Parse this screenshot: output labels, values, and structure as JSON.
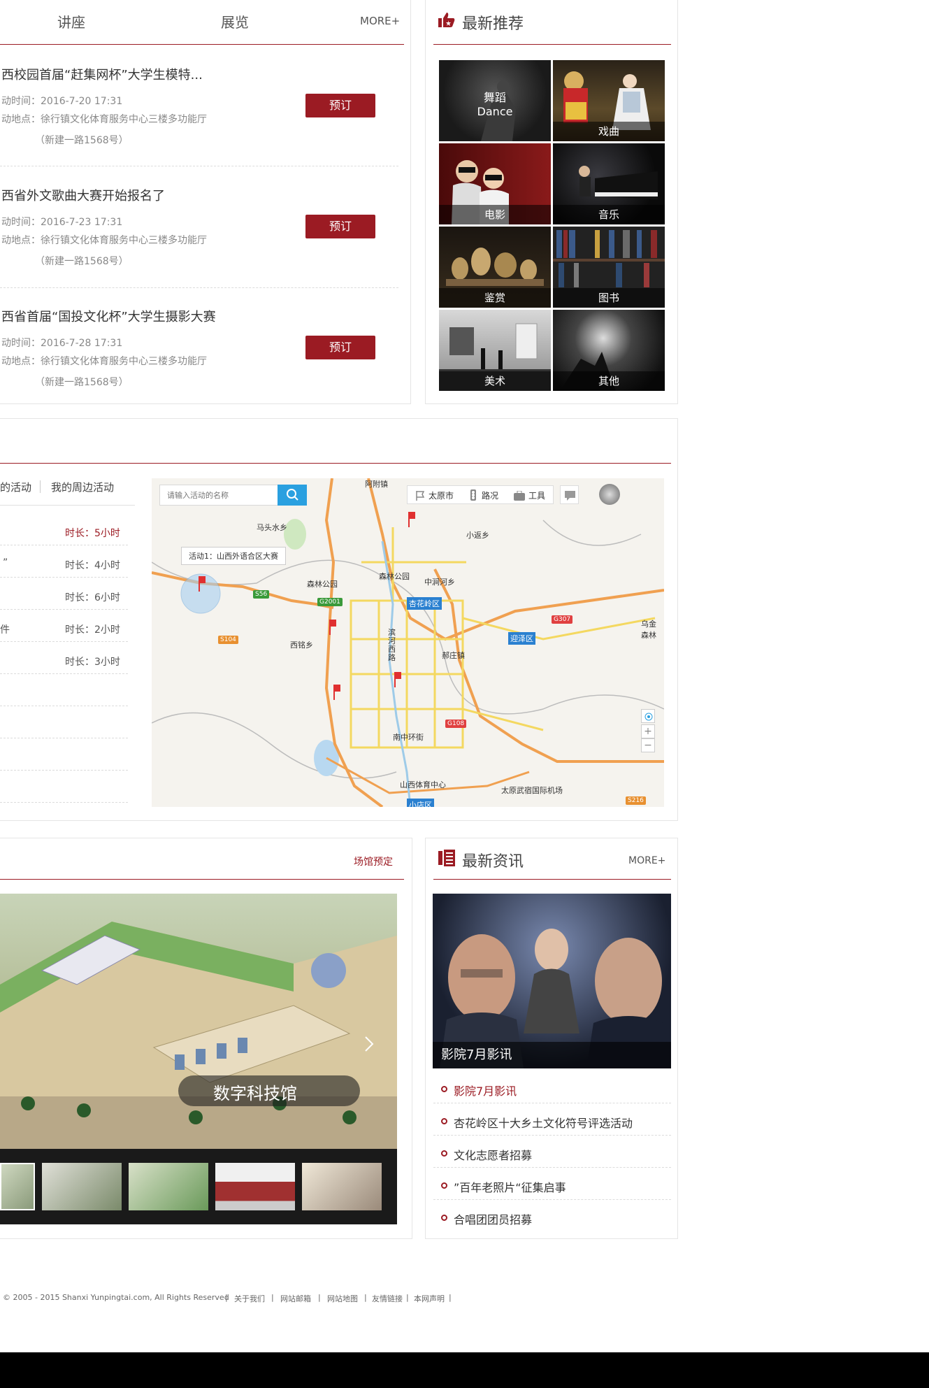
{
  "activities": {
    "tabs": [
      "讲座",
      "展览"
    ],
    "more": "MORE+",
    "items": [
      {
        "title": "西校园首届“赶集网杯”大学生模特...",
        "time": "动时间：2016-7-20 17:31",
        "place": "动地点：徐行镇文化体育服务中心三楼多功能厅",
        "address": "（新建一路1568号）",
        "button": "预订"
      },
      {
        "title": "西省外文歌曲大赛开始报名了",
        "time": "动时间：2016-7-23 17:31",
        "place": "动地点：徐行镇文化体育服务中心三楼多功能厅",
        "address": "（新建一路1568号）",
        "button": "预订"
      },
      {
        "title": "西省首届“国投文化杯”大学生摄影大赛",
        "time": "动时间：2016-7-28 17:31",
        "place": "动地点：徐行镇文化体育服务中心三楼多功能厅",
        "address": "（新建一路1568号）",
        "button": "预订"
      }
    ]
  },
  "recommend": {
    "title": "最新推荐",
    "tiles": [
      {
        "label": "舞蹈",
        "sublabel": "Dance"
      },
      {
        "label": "戏曲"
      },
      {
        "label": "电影"
      },
      {
        "label": "音乐"
      },
      {
        "label": "鉴赏"
      },
      {
        "label": "图书"
      },
      {
        "label": "美术"
      },
      {
        "label": "其他"
      }
    ]
  },
  "nearby": {
    "tabs": [
      "的活动",
      "我的周边活动"
    ],
    "rows": [
      {
        "name": "",
        "duration": "时长：5小时",
        "highlight": true
      },
      {
        "name": "”",
        "duration": "时长：4小时"
      },
      {
        "name": "",
        "duration": "时长：6小时"
      },
      {
        "name": "件",
        "duration": "时长：2小时"
      },
      {
        "name": "",
        "duration": "时长：3小时"
      }
    ],
    "map": {
      "search_placeholder": "请输入活动的名称",
      "city": "太原市",
      "traffic": "路况",
      "tools": "工具",
      "popup": "活动1：山西外语合区大赛",
      "places": [
        "阿附镇",
        "马头水乡",
        "小返乡",
        "森林公园",
        "森林公园",
        "中涧河乡",
        "杏花岭区",
        "迎泽区",
        "西铭乡",
        "郝庄镇",
        "乌金森林",
        "南中环街",
        "山西体育中心",
        "太原武宿国际机场",
        "滨河西路",
        "小店区"
      ],
      "roads": [
        "S56",
        "G2001",
        "S104",
        "G307",
        "G108",
        "S216"
      ]
    }
  },
  "venue": {
    "link": "场馆预定",
    "caption": "数字科技馆"
  },
  "news": {
    "title": "最新资讯",
    "more": "MORE+",
    "feature_caption": "影院7月影讯",
    "items": [
      "影院7月影讯",
      "杏花岭区十大乡土文化符号评选活动",
      "文化志愿者招募",
      "”百年老照片“征集启事",
      "合唱团团员招募"
    ]
  },
  "footer": {
    "copyright": "© 2005 - 2015 Shanxi Yunpingtai.com, All Rights Reserved",
    "links": [
      "关于我们",
      "网站邮箱",
      "网站地图",
      "友情链接",
      "本网声明"
    ]
  },
  "colors": {
    "accent": "#9b1b23",
    "link_blue": "#2aa0e0"
  }
}
